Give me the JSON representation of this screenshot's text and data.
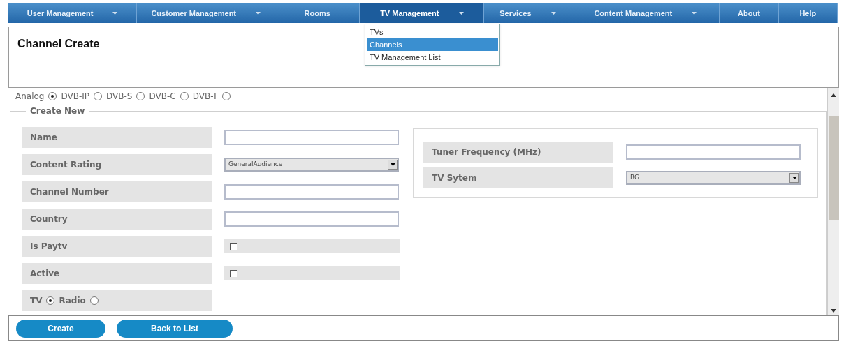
{
  "nav": [
    {
      "label": "User Management",
      "dropdown": true,
      "selected": false
    },
    {
      "label": "Customer Management",
      "dropdown": true,
      "selected": false
    },
    {
      "label": "Rooms",
      "dropdown": false,
      "selected": false
    },
    {
      "label": "TV Management",
      "dropdown": true,
      "selected": true
    },
    {
      "label": "Services",
      "dropdown": true,
      "selected": false
    },
    {
      "label": "Content Management",
      "dropdown": true,
      "selected": false
    },
    {
      "label": "About",
      "dropdown": false,
      "selected": false
    },
    {
      "label": "Help",
      "dropdown": false,
      "selected": false
    }
  ],
  "menu": [
    {
      "label": "TVs",
      "selected": false
    },
    {
      "label": "Channels",
      "selected": true
    },
    {
      "label": "TV Management List",
      "selected": false
    }
  ],
  "page_title": "Channel Create",
  "signal_types": [
    {
      "label": "Analog",
      "selected": true
    },
    {
      "label": "DVB-IP",
      "selected": false
    },
    {
      "label": "DVB-S",
      "selected": false
    },
    {
      "label": "DVB-C",
      "selected": false
    },
    {
      "label": "DVB-T",
      "selected": false
    }
  ],
  "fieldset_legend": "Create New",
  "fields": [
    {
      "label": "Name",
      "kind": "text"
    },
    {
      "label": "Content Rating",
      "kind": "select",
      "value": "GeneralAudience"
    },
    {
      "label": "Channel Number",
      "kind": "text"
    },
    {
      "label": "Country",
      "kind": "text"
    },
    {
      "label": "Is Paytv",
      "kind": "checkbox",
      "checked": false
    },
    {
      "label": "Active",
      "kind": "checkbox",
      "checked": false
    }
  ],
  "media_types": [
    {
      "label": "TV",
      "selected": true
    },
    {
      "label": "Radio",
      "selected": false
    }
  ],
  "tuner_fields": [
    {
      "label": "Tuner Frequency (MHz)",
      "kind": "text"
    },
    {
      "label": "TV Sytem",
      "kind": "select",
      "value": "BG"
    }
  ],
  "buttons": [
    "Create",
    "Back to List"
  ]
}
